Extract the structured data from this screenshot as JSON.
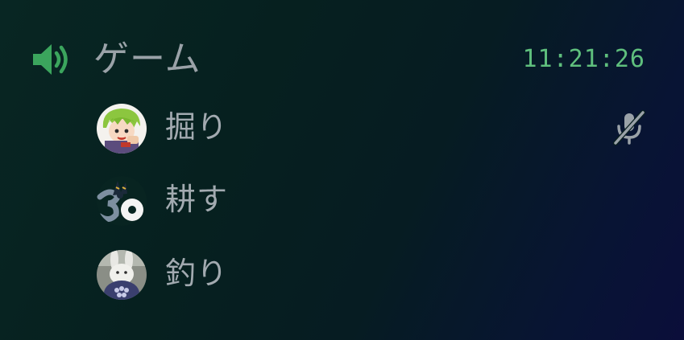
{
  "channel": {
    "name": "ゲーム",
    "timer": "11:21:26",
    "icon": "speaker-volume-icon",
    "icon_color": "#3ba55d"
  },
  "members": [
    {
      "name": "掘り",
      "avatar": "anime-character-avatar",
      "muted": true,
      "status_icon": "microphone-muted-icon"
    },
    {
      "name": "耕す",
      "avatar": "30-logo-avatar",
      "muted": false
    },
    {
      "name": "釣り",
      "avatar": "rabbit-figure-avatar",
      "muted": false
    }
  ]
}
